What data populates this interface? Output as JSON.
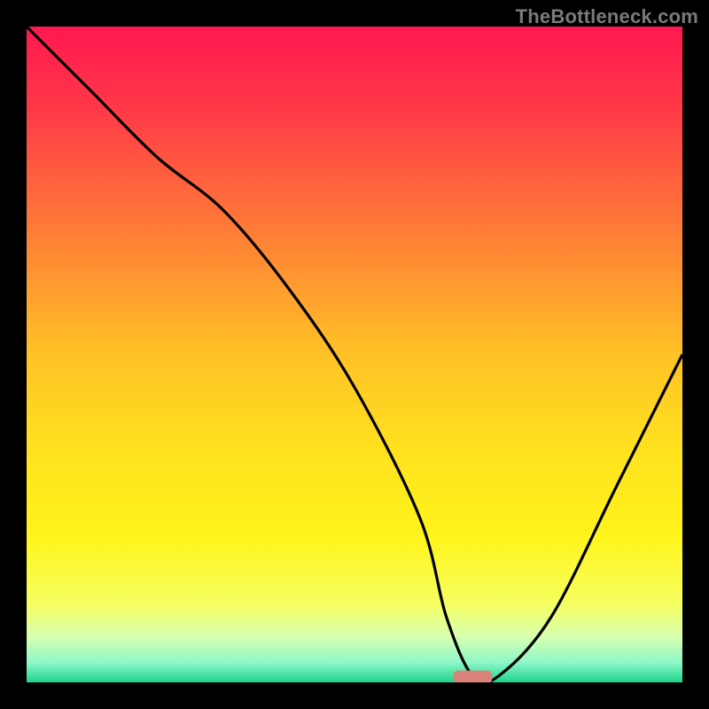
{
  "watermark": "TheBottleneck.com",
  "chart_data": {
    "type": "line",
    "title": "",
    "xlabel": "",
    "ylabel": "",
    "xlim": [
      0,
      100
    ],
    "ylim": [
      0,
      100
    ],
    "x": [
      0,
      10,
      20,
      30,
      40,
      50,
      60,
      64,
      68,
      72,
      80,
      90,
      100
    ],
    "values": [
      100,
      90,
      80,
      72,
      60,
      45,
      25,
      10,
      1,
      1,
      10,
      30,
      50
    ],
    "minimum_marker": {
      "x": 68,
      "y": 0.8,
      "width": 6,
      "height": 2
    },
    "background_gradient": {
      "stops": [
        {
          "offset": 0.0,
          "color": "#ff1850"
        },
        {
          "offset": 0.12,
          "color": "#ff3748"
        },
        {
          "offset": 0.3,
          "color": "#ff7838"
        },
        {
          "offset": 0.5,
          "color": "#ffc226"
        },
        {
          "offset": 0.65,
          "color": "#ffe21e"
        },
        {
          "offset": 0.78,
          "color": "#fff41c"
        },
        {
          "offset": 0.88,
          "color": "#f6ff60"
        },
        {
          "offset": 0.93,
          "color": "#d8ffb0"
        },
        {
          "offset": 0.97,
          "color": "#8cf7c8"
        },
        {
          "offset": 1.0,
          "color": "#1fd38b"
        }
      ]
    },
    "line_color": "#000000",
    "marker_color": "#d9837a"
  }
}
